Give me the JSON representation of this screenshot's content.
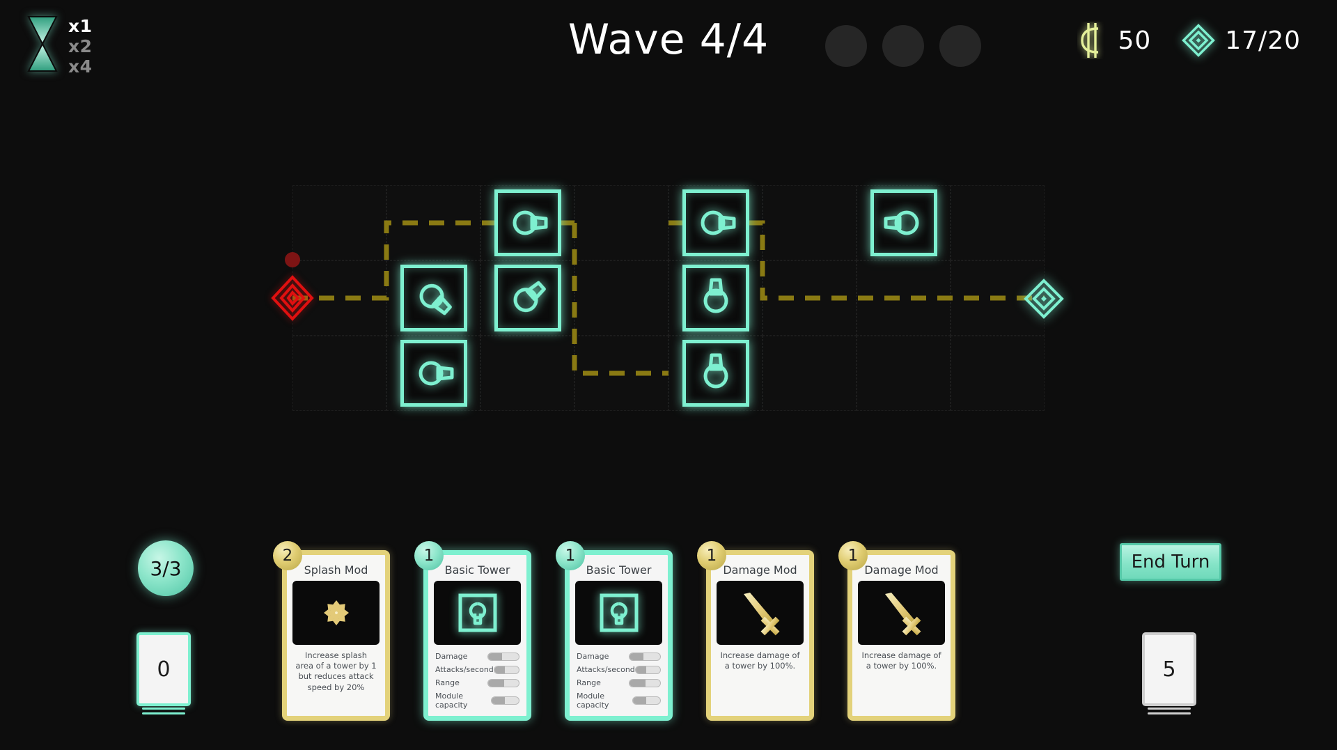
{
  "hud": {
    "speed": {
      "icon": "hourglass-icon",
      "options": [
        "x1",
        "x2",
        "x4"
      ],
      "active_index": 0
    },
    "wave_label": "Wave 4/4",
    "wave_dots": [
      false,
      false,
      false
    ],
    "currency": {
      "icon": "cedi-coin-icon",
      "value": "50",
      "color": "#e4ef9a"
    },
    "lives": {
      "icon": "core-diamond-icon",
      "value": "17/20",
      "color": "#7ef0d0"
    }
  },
  "board": {
    "columns": 8,
    "rows": 3,
    "spawn": {
      "icon": "spiral-diamond-spawn-icon",
      "col": 0,
      "row": 1,
      "color": "#e01010"
    },
    "goal": {
      "icon": "core-diamond-goal-icon",
      "col": 7,
      "row": 1,
      "color": "#7ef0d0"
    },
    "enemy": {
      "label": "enemy-unit",
      "color": "#7d1414"
    },
    "path_color": "#8a7a13",
    "towers": [
      {
        "col": 2,
        "row": 0,
        "facing": "right",
        "name": "basic-tower"
      },
      {
        "col": 4,
        "row": 0,
        "facing": "right",
        "name": "basic-tower"
      },
      {
        "col": 1,
        "row": 1,
        "facing": "down-right",
        "name": "basic-tower"
      },
      {
        "col": 2,
        "row": 1,
        "facing": "up-right",
        "name": "basic-tower"
      },
      {
        "col": 4,
        "row": 1,
        "facing": "up",
        "name": "basic-tower"
      },
      {
        "col": 6,
        "row": 0,
        "facing": "left",
        "name": "basic-tower"
      },
      {
        "col": 1,
        "row": 2,
        "facing": "right",
        "name": "basic-tower"
      },
      {
        "col": 4,
        "row": 2,
        "facing": "up",
        "name": "basic-tower"
      }
    ]
  },
  "bottom": {
    "energy": "3/3",
    "draw_pile_count": "0",
    "discard_pile_count": "5",
    "end_turn_label": "End Turn",
    "cards": [
      {
        "name": "Splash Mod",
        "cost": "2",
        "kind": "mod",
        "art_icon": "splash-arrows-icon",
        "description": "Increase splash area of a tower by 1 but reduces attack speed by 20%"
      },
      {
        "name": "Basic Tower",
        "cost": "1",
        "kind": "tower",
        "art_icon": "tower-keyhole-icon",
        "stats": [
          {
            "label": "Damage",
            "fill": 45
          },
          {
            "label": "Attacks/second",
            "fill": 42
          },
          {
            "label": "Range",
            "fill": 52
          },
          {
            "label": "Module capacity",
            "fill": 48
          }
        ]
      },
      {
        "name": "Basic Tower",
        "cost": "1",
        "kind": "tower",
        "art_icon": "tower-keyhole-icon",
        "stats": [
          {
            "label": "Damage",
            "fill": 45
          },
          {
            "label": "Attacks/second",
            "fill": 42
          },
          {
            "label": "Range",
            "fill": 52
          },
          {
            "label": "Module capacity",
            "fill": 48
          }
        ]
      },
      {
        "name": "Damage Mod",
        "cost": "1",
        "kind": "mod",
        "art_icon": "sword-icon",
        "description": "Increase damage of a tower by 100%."
      },
      {
        "name": "Damage Mod",
        "cost": "1",
        "kind": "mod",
        "art_icon": "sword-icon",
        "description": "Increase damage of a tower by 100%."
      }
    ]
  }
}
